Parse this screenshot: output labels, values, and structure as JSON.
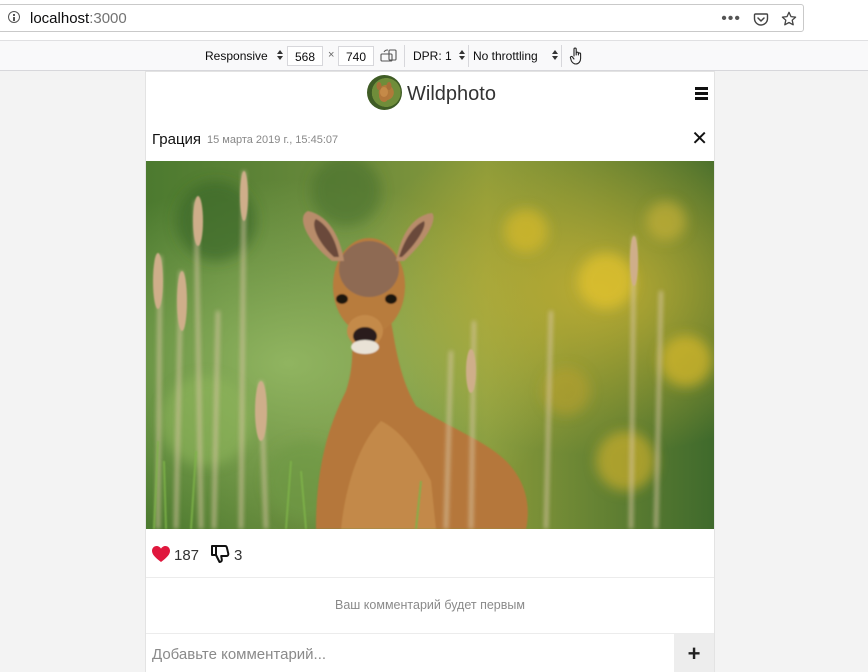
{
  "browser": {
    "url_host": "localhost",
    "url_port": ":3000"
  },
  "rdm": {
    "device": "Responsive",
    "width": "568",
    "times": "×",
    "height": "740",
    "dpr": "DPR: 1",
    "throttling": "No throttling"
  },
  "app": {
    "brand": "Wildphoto"
  },
  "post": {
    "author": "Грация",
    "date": "15 марта 2019 г., 15:45:07",
    "likes": "187",
    "dislikes": "3",
    "empty_comments": "Ваш комментарий будет первым",
    "comment_placeholder": "Добавьте комментарий...",
    "add_label": "+"
  },
  "icons": {
    "info": "info-icon",
    "more": "more-dots-icon",
    "pocket": "pocket-icon",
    "bookmark": "star-icon",
    "rotate": "rotate-icon",
    "touch": "touch-pointer-icon",
    "menu": "hamburger-icon",
    "close": "close-icon",
    "like": "heart-icon",
    "dislike": "thumbs-down-icon"
  },
  "colors": {
    "like": "#e0173d"
  }
}
